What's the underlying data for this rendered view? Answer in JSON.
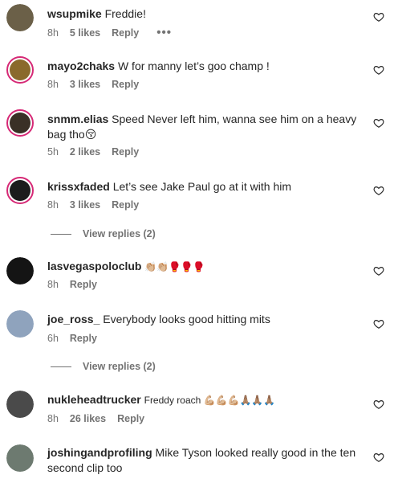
{
  "comments": [
    {
      "user": "wsupmike",
      "text": "Freddie!",
      "time": "8h",
      "likes": "5 likes",
      "reply": "Reply",
      "more": "•••",
      "avatar_color": "#6b6048"
    },
    {
      "user": "mayo2chaks",
      "text": "W for manny let’s goo champ !",
      "time": "8h",
      "likes": "3 likes",
      "reply": "Reply",
      "avatar_color": "#8a6a2c"
    },
    {
      "user": "snmm.elias",
      "text": "Speed Never left him, wanna see him on a heavy bag tho😚",
      "time": "5h",
      "likes": "2 likes",
      "reply": "Reply",
      "avatar_color": "#3a3026"
    },
    {
      "user": "krissxfaded",
      "text": "Let’s see Jake Paul go at it with him",
      "time": "8h",
      "likes": "3 likes",
      "reply": "Reply",
      "view_replies": "View replies (2)",
      "avatar_color": "#1c1c1c"
    },
    {
      "user": "lasvegaspoloclub",
      "text": "👏🏼👏🏼🥊🥊🥊",
      "time": "8h",
      "reply": "Reply",
      "avatar_color": "#141414"
    },
    {
      "user": "joe_ross_",
      "text": "Everybody looks good hitting mits",
      "time": "6h",
      "reply": "Reply",
      "view_replies": "View replies (2)",
      "avatar_color": "#8fa3bd"
    },
    {
      "user": "nukleheadtrucker",
      "text": "Freddy roach 💪🏼💪🏼💪🏼🙏🏽🙏🏽🙏🏽",
      "time": "8h",
      "likes": "26 likes",
      "reply": "Reply",
      "avatar_color": "#4a4a4a"
    },
    {
      "user": "joshingandprofiling",
      "text": "Mike Tyson looked really good in the ten second clip too",
      "avatar_color": "#6d7a70"
    }
  ]
}
